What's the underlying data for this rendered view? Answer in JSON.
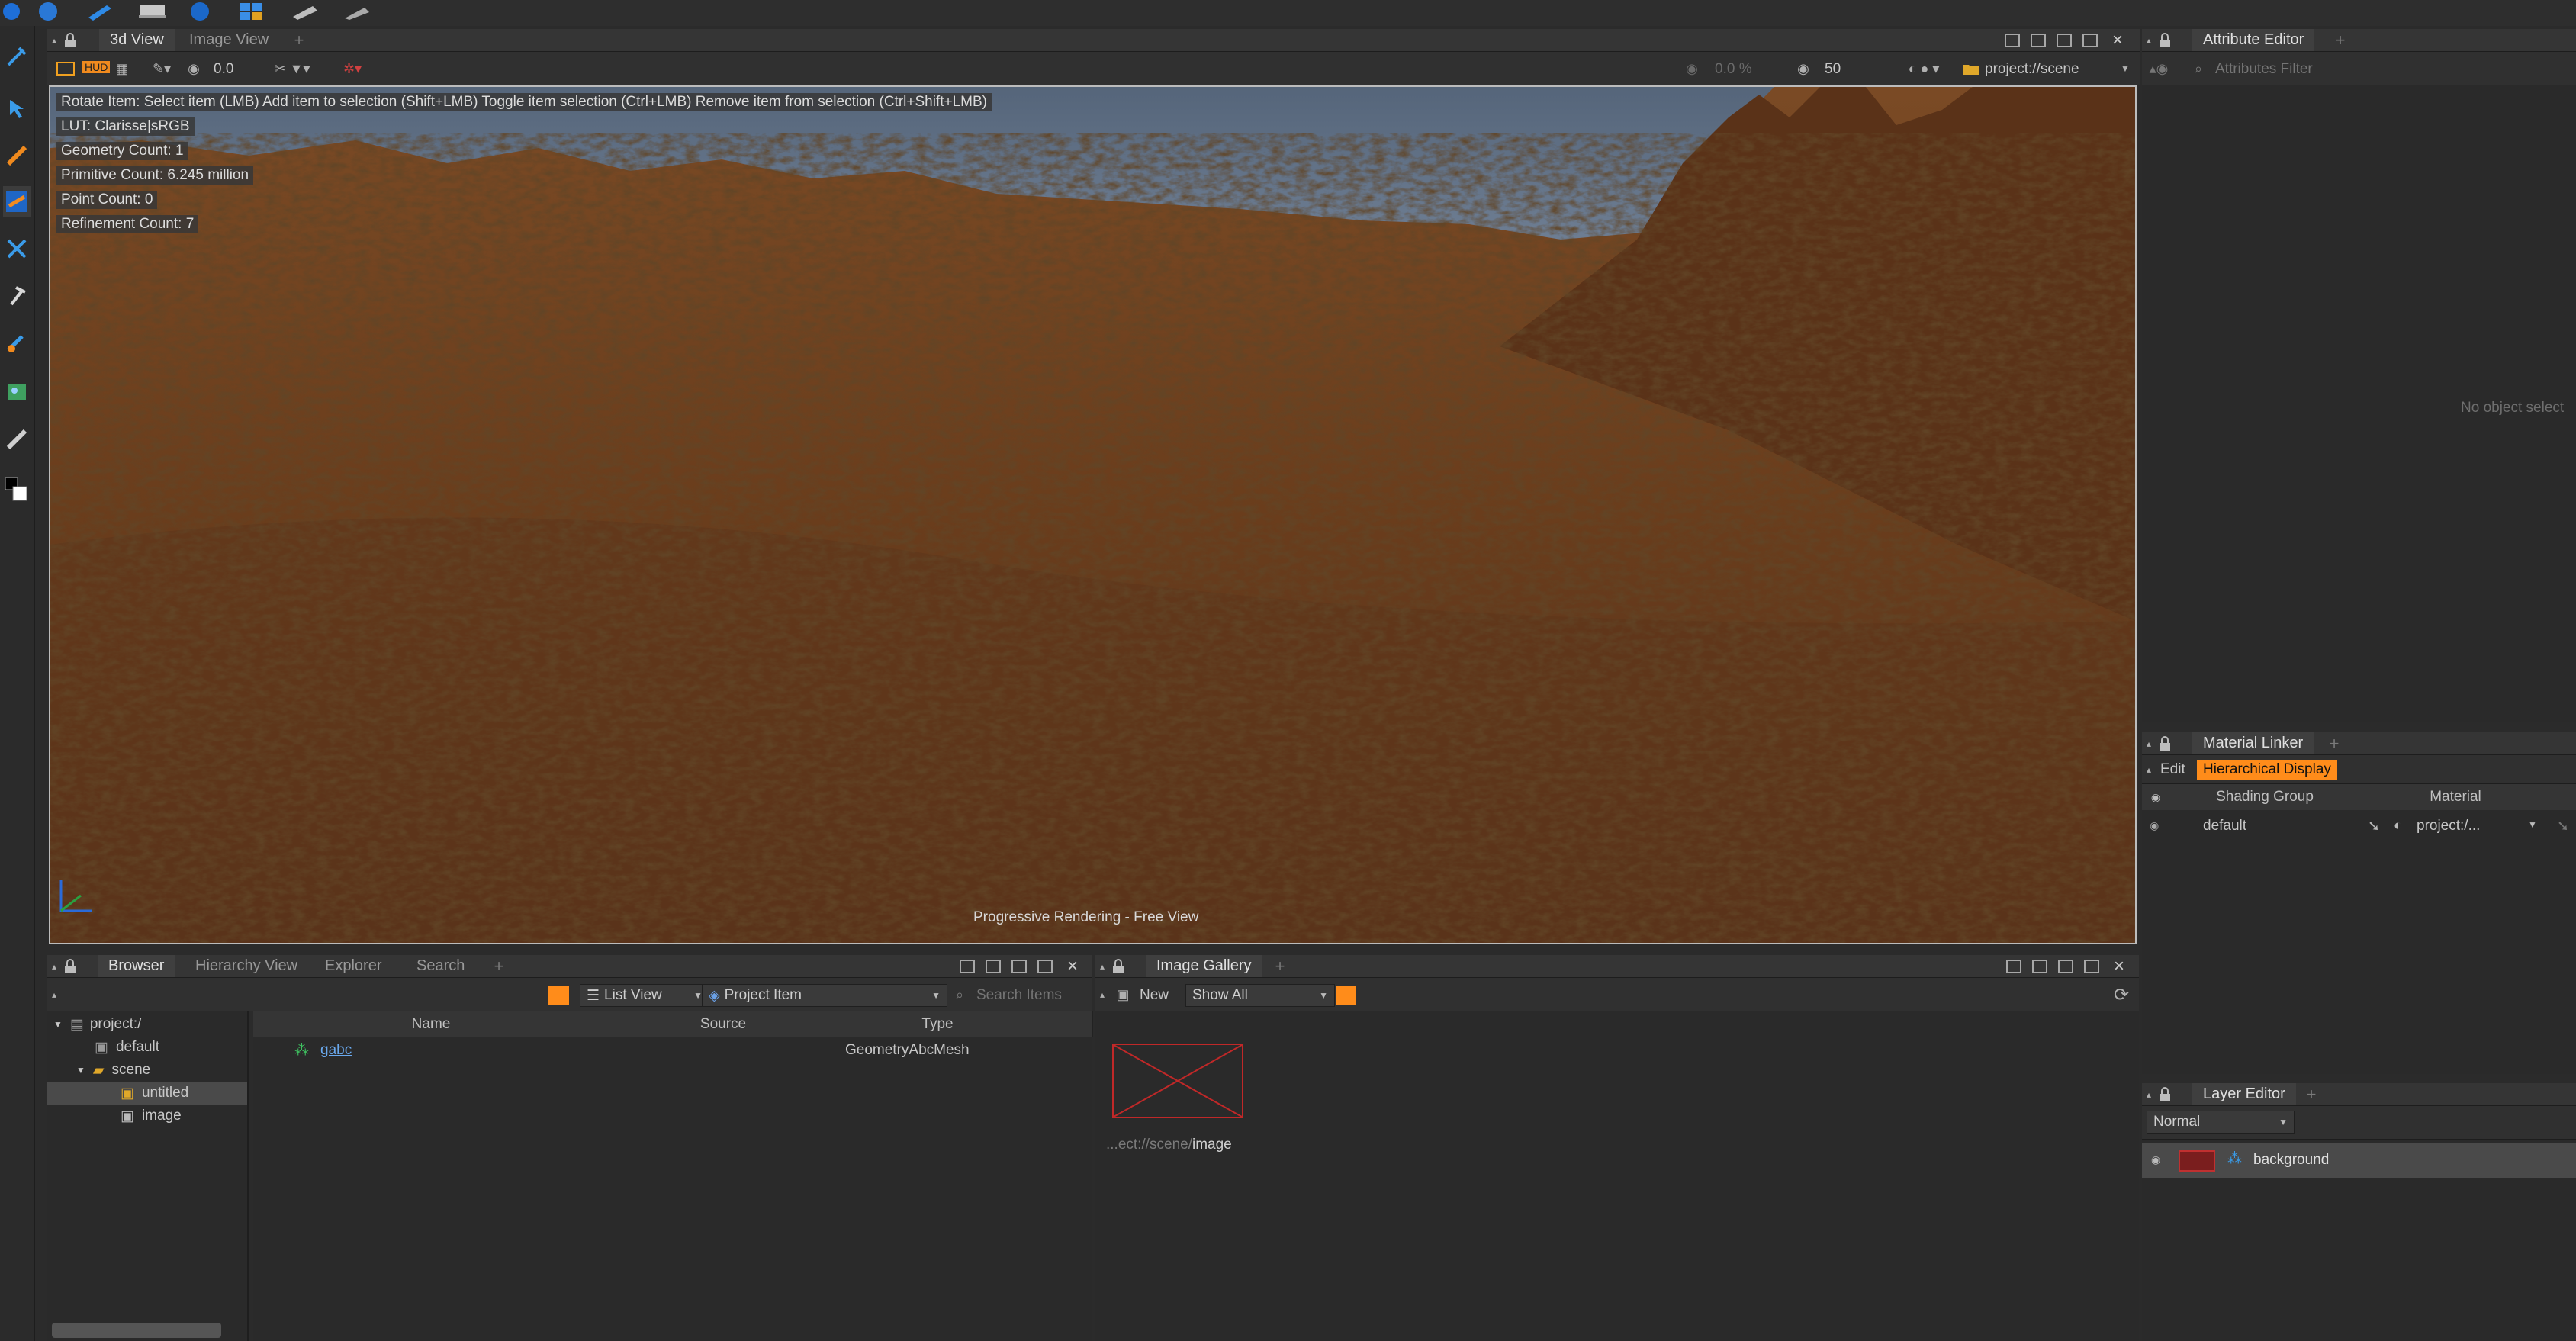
{
  "viewport_tabs": [
    "3d View",
    "Image View"
  ],
  "viewport_toolbar": {
    "hud_label": "HUD",
    "exposure": "0.0",
    "progress": "0.0 %",
    "samples": "50",
    "scene_path": "project://scene"
  },
  "hud": {
    "help_line": "Rotate Item: Select item (LMB)  Add item to selection (Shift+LMB)  Toggle item selection (Ctrl+LMB)  Remove item from selection (Ctrl+Shift+LMB)",
    "lut": "LUT: Clarisse|sRGB",
    "geometry_count": "Geometry Count: 1",
    "primitive_count": "Primitive Count: 6.245 million",
    "point_count": "Point Count: 0",
    "refinement_count": "Refinement Count: 7",
    "status": "Progressive Rendering - Free View"
  },
  "attribute_editor": {
    "tab": "Attribute Editor",
    "filter_placeholder": "Attributes Filter",
    "empty_message": "No object select"
  },
  "material_linker": {
    "tab": "Material Linker",
    "edit_label": "Edit",
    "hier_label": "Hierarchical Display",
    "col_shading": "Shading Group",
    "col_material": "Material",
    "row_group": "default",
    "row_material": "project:/..."
  },
  "layer_editor": {
    "tab": "Layer Editor",
    "blend_mode": "Normal",
    "layer_name": "background"
  },
  "browser": {
    "tabs": [
      "Browser",
      "Hierarchy View",
      "Explorer",
      "Search"
    ],
    "list_view": "List View",
    "project_item": "Project Item",
    "search_placeholder": "Search Items",
    "tree": [
      "project:/",
      "default",
      "scene",
      "untitled",
      "image"
    ],
    "columns": [
      "Name",
      "Source",
      "Type"
    ],
    "rows": [
      {
        "name": "gabc",
        "source": "",
        "type": "GeometryAbcMesh"
      }
    ]
  },
  "image_gallery": {
    "tab": "Image Gallery",
    "new_label": "New",
    "show_all": "Show All",
    "thumb_label_prefix": "...ect://scene/",
    "thumb_label_name": "image"
  },
  "colors": {
    "accent": "#ff8c1a",
    "terrain": "#6b3d1c",
    "sky": "#6a7a8a",
    "selection": "#4a4a4a"
  }
}
